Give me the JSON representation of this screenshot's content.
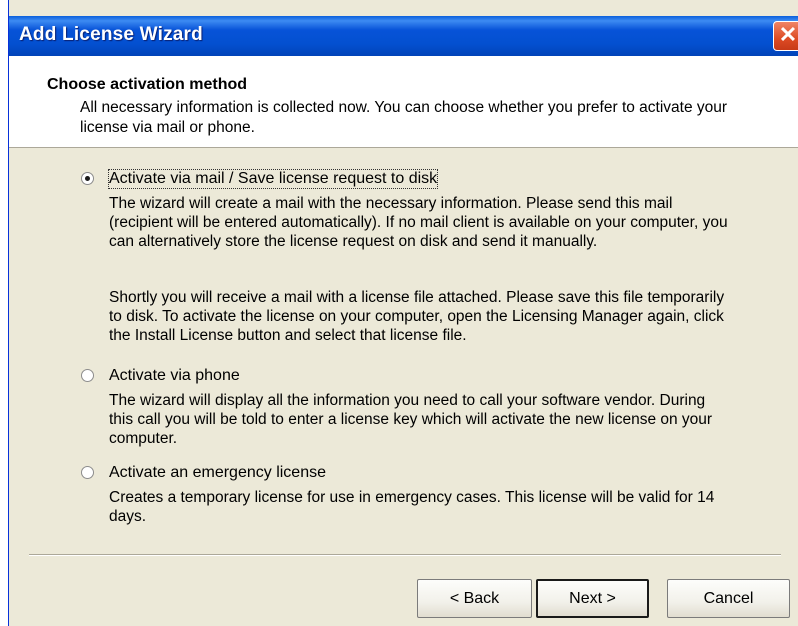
{
  "window": {
    "title": "Add License Wizard",
    "close_symbol": "✕"
  },
  "header": {
    "title": "Choose activation method",
    "description": "All necessary information is collected now. You can choose whether you prefer to activate your license via mail or phone."
  },
  "options": [
    {
      "label": "Activate via mail / Save license request to disk",
      "checked": true,
      "descriptions": [
        "The wizard will create a mail with the necessary information. Please send this mail (recipient will be entered automatically). If no mail client is available on your computer, you can alternatively store the license request on disk and send it manually.",
        "Shortly you will receive a mail with a license file attached. Please save this file temporarily to disk. To activate the license on your computer, open the Licensing Manager again, click the Install License button and select that license file."
      ]
    },
    {
      "label": "Activate via phone",
      "checked": false,
      "descriptions": [
        "The wizard will display all the information you need to call your software vendor. During this call you will be told to enter a license key which will activate the new license on your computer."
      ]
    },
    {
      "label": "Activate an emergency license",
      "checked": false,
      "descriptions": [
        "Creates a temporary license for use in emergency cases. This license will be valid for 14 days."
      ]
    }
  ],
  "buttons": {
    "back": "< Back",
    "next": "Next >",
    "cancel": "Cancel"
  },
  "colors": {
    "titlebar": "#0350d0",
    "dialog_bg": "#ece9d8",
    "close_button": "#dd4b24"
  }
}
